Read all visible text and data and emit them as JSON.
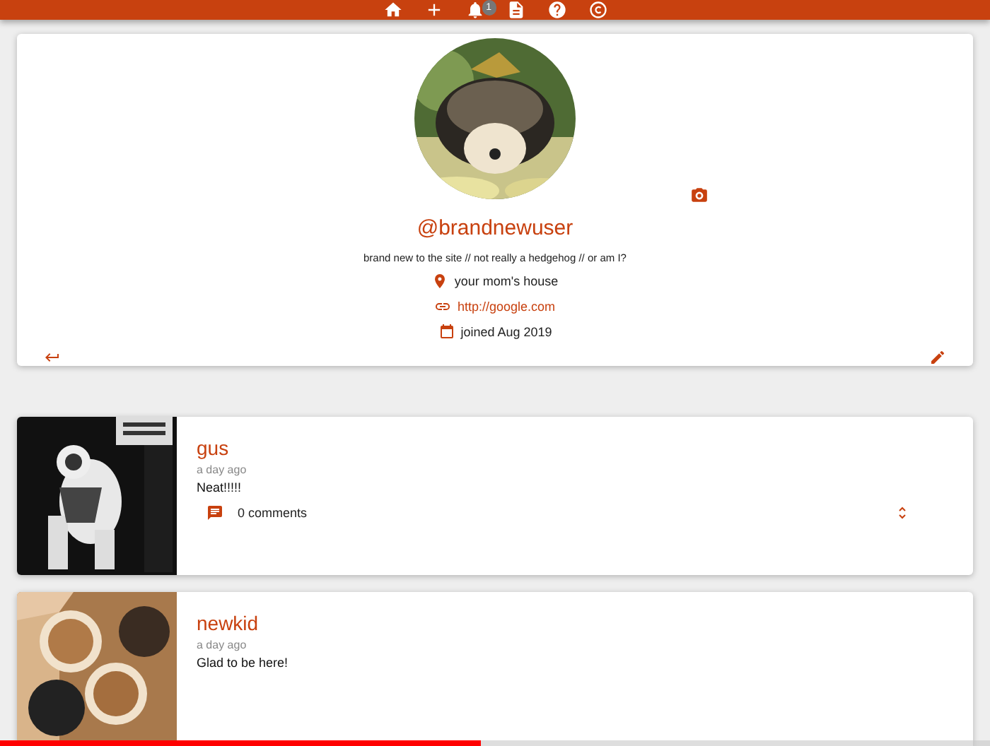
{
  "top_bar": {
    "notification_count": "1"
  },
  "profile": {
    "username": "@brandnewuser",
    "bio": "brand new to the site // not really a hedgehog // or am I?",
    "location": "your mom's house",
    "website": "http://google.com",
    "joined": "joined Aug 2019"
  },
  "posts": [
    {
      "username": "gus",
      "time": "a day ago",
      "body": "Neat!!!!!",
      "comments": "0 comments"
    },
    {
      "username": "newkid",
      "time": "a day ago",
      "body": "Glad to be here!"
    }
  ],
  "video_progress": {
    "level": 0.485
  }
}
